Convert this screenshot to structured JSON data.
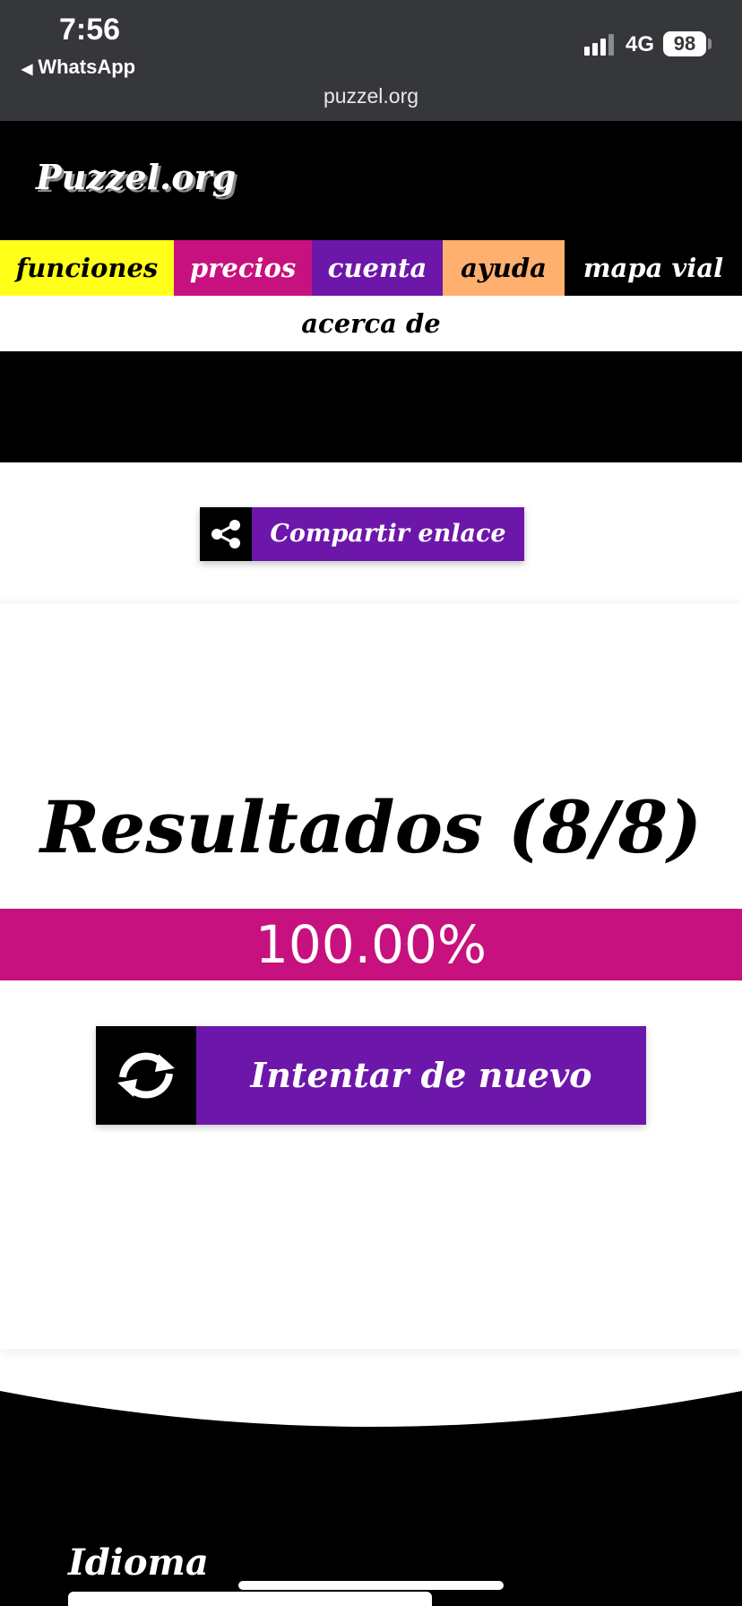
{
  "status_bar": {
    "time": "7:56",
    "back_app": "WhatsApp",
    "network": "4G",
    "battery": "98",
    "url": "puzzel.org"
  },
  "header": {
    "logo": "Puzzel.org"
  },
  "nav": {
    "items": [
      {
        "label": "funciones",
        "color": "#ffff1a"
      },
      {
        "label": "precios",
        "color": "#c7117e"
      },
      {
        "label": "cuenta",
        "color": "#6c17a9"
      },
      {
        "label": "ayuda",
        "color": "#ffaf6e"
      },
      {
        "label": "mapa vial",
        "color": "#000000"
      }
    ],
    "secondary": "acerca de"
  },
  "share": {
    "label": "Compartir enlace",
    "icon": "share-icon"
  },
  "results": {
    "title": "Resultados (8/8)",
    "score": "100.00%",
    "retry_label": "Intentar de nuevo",
    "retry_icon": "refresh-icon"
  },
  "footer": {
    "language_label": "Idioma"
  },
  "colors": {
    "purple": "#6c17a9",
    "magenta": "#c7117e",
    "yellow": "#ffff1a",
    "orange": "#ffaf6e",
    "black": "#000000"
  }
}
